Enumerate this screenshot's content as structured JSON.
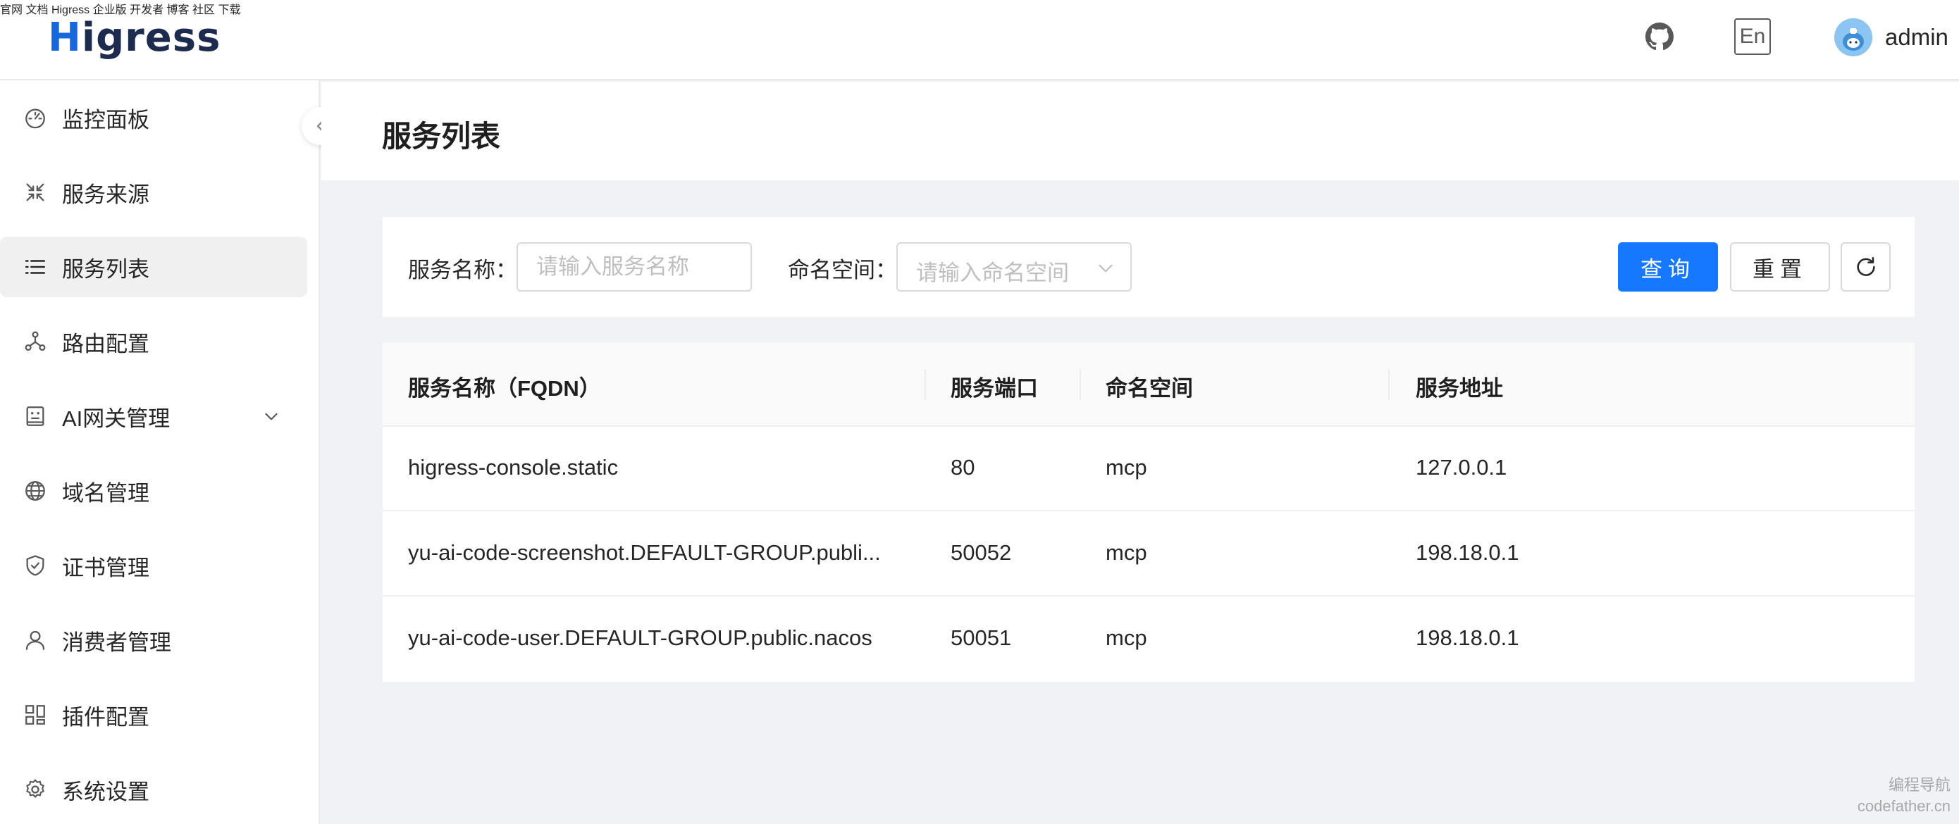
{
  "header": {
    "logo": {
      "first_letter": "H",
      "rest": "igress"
    },
    "nav": [
      "官网",
      "文档",
      "Higress 企业版",
      "开发者",
      "博客",
      "社区",
      "下载"
    ],
    "lang_button": "En",
    "username": "admin"
  },
  "sidebar": {
    "items": [
      {
        "label": "监控面板",
        "icon": "dashboard-icon"
      },
      {
        "label": "服务来源",
        "icon": "shrink-arrows-icon"
      },
      {
        "label": "服务列表",
        "icon": "list-icon",
        "active": true
      },
      {
        "label": "路由配置",
        "icon": "route-nodes-icon"
      },
      {
        "label": "AI网关管理",
        "icon": "robot-icon",
        "expandable": true
      },
      {
        "label": "域名管理",
        "icon": "globe-icon"
      },
      {
        "label": "证书管理",
        "icon": "shield-check-icon"
      },
      {
        "label": "消费者管理",
        "icon": "user-icon"
      },
      {
        "label": "插件配置",
        "icon": "plugin-blocks-icon"
      },
      {
        "label": "系统设置",
        "icon": "gear-icon"
      }
    ]
  },
  "page": {
    "title": "服务列表"
  },
  "search": {
    "name_label": "服务名称",
    "name_placeholder": "请输入服务名称",
    "name_value": "",
    "namespace_label": "命名空间",
    "namespace_placeholder": "请输入命名空间",
    "query_button": "查询",
    "reset_button": "重置"
  },
  "table": {
    "columns": [
      "服务名称（FQDN）",
      "服务端口",
      "命名空间",
      "服务地址"
    ],
    "rows": [
      [
        "higress-console.static",
        "80",
        "mcp",
        "127.0.0.1"
      ],
      [
        "yu-ai-code-screenshot.DEFAULT-GROUP.publi...",
        "50052",
        "mcp",
        "198.18.0.1"
      ],
      [
        "yu-ai-code-user.DEFAULT-GROUP.public.nacos",
        "50051",
        "mcp",
        "198.18.0.1"
      ]
    ]
  },
  "watermark": {
    "line1": "编程导航",
    "line2": "codefather.cn"
  },
  "colors": {
    "primary": "#1677ff",
    "logo_h": "#1668dc",
    "logo_text": "#1d2b4f",
    "active_bg": "#f0f0f0"
  }
}
